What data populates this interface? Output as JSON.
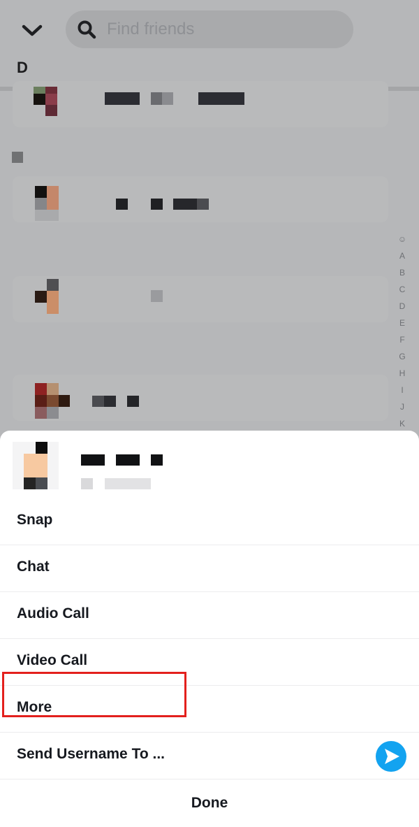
{
  "search": {
    "placeholder": "Find friends"
  },
  "section_letter": "D",
  "alpha_index": [
    "☺",
    "A",
    "B",
    "C",
    "D",
    "E",
    "F",
    "G",
    "H",
    "I",
    "J",
    "K"
  ],
  "menu": {
    "items": [
      {
        "label": "Snap"
      },
      {
        "label": "Chat"
      },
      {
        "label": "Audio Call"
      },
      {
        "label": "Video Call"
      },
      {
        "label": "More"
      },
      {
        "label": "Send Username To ..."
      }
    ],
    "done_label": "Done"
  },
  "colors": {
    "highlight": "#e3201d",
    "send_button": "#13a3f0",
    "overlay": "#b6b7b9"
  }
}
